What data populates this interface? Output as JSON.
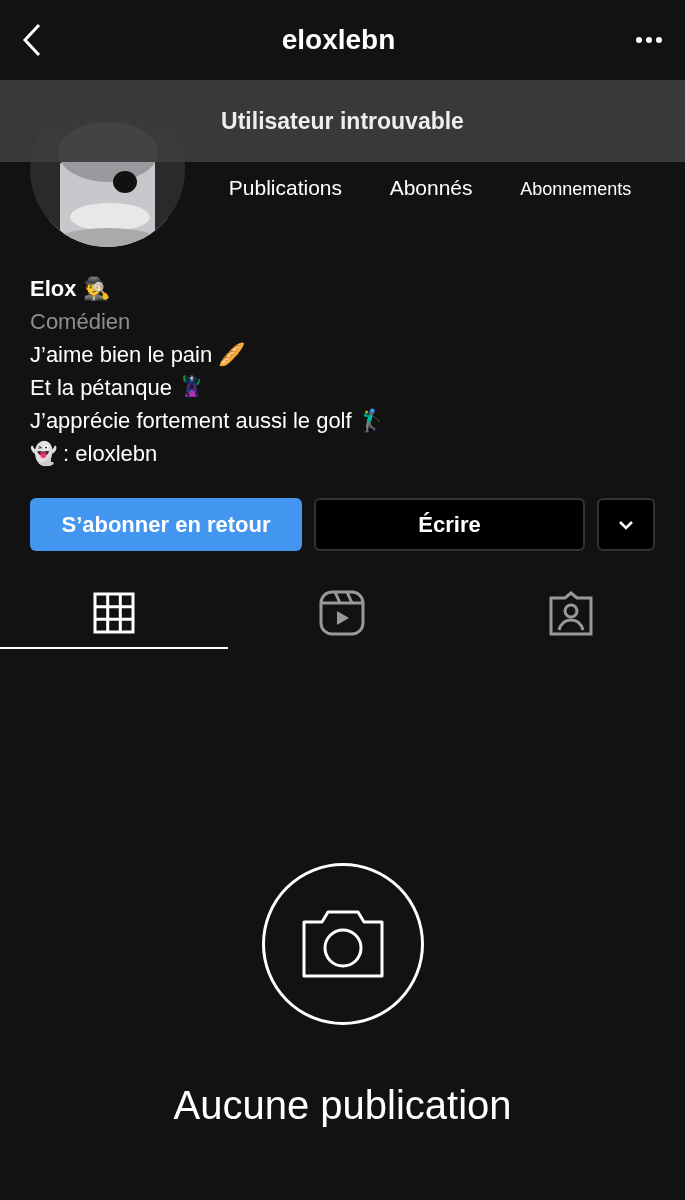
{
  "header": {
    "title": "eloxlebn"
  },
  "banner": {
    "text": "Utilisateur introuvable"
  },
  "profile": {
    "stats": [
      {
        "label": "Publications"
      },
      {
        "label": "Abonnés"
      },
      {
        "label": "Abonnements"
      }
    ],
    "name": "Elox 🕵️‍♂️",
    "category": "Comédien",
    "bio": [
      "J’aime bien le pain 🥖",
      "Et la pétanque 🦹‍♀️",
      "J’apprécie fortement aussi le golf 🏌️‍♂️",
      "👻 : eloxlebn"
    ]
  },
  "actions": [
    {
      "kind": "primary",
      "label": "S’abonner en retour"
    },
    {
      "kind": "secondary",
      "label": "Écrire"
    },
    {
      "kind": "more"
    }
  ],
  "tabs": [
    {
      "kind": "grid",
      "selected": true
    },
    {
      "kind": "reels",
      "selected": false
    },
    {
      "kind": "tagged",
      "selected": false
    }
  ],
  "empty_state": {
    "text": "Aucune publication"
  }
}
